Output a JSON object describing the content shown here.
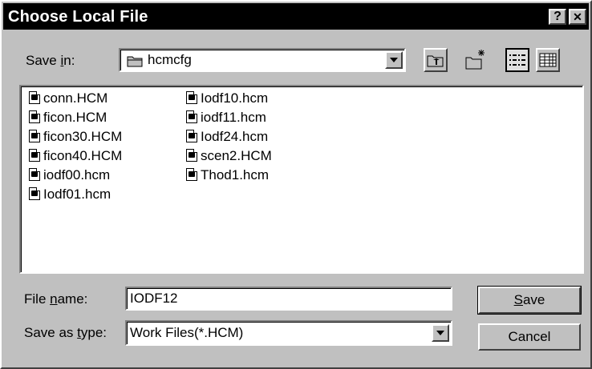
{
  "window": {
    "title": "Choose Local File",
    "help_glyph": "?",
    "close_glyph": "✕"
  },
  "save_in": {
    "label_pre": "Save ",
    "label_key": "i",
    "label_post": "n:",
    "value": "hcmcfg",
    "icon": "folder-icon"
  },
  "toolbar": {
    "up_icon": "up-folder-icon",
    "new_icon": "new-folder-icon",
    "list_icon": "list-view-icon",
    "details_icon": "details-view-icon"
  },
  "files": [
    "conn.HCM",
    "ficon.HCM",
    "ficon30.HCM",
    "ficon40.HCM",
    "iodf00.hcm",
    "Iodf01.hcm",
    "Iodf10.hcm",
    "iodf11.hcm",
    "Iodf24.hcm",
    "scen2.HCM",
    "Thod1.hcm"
  ],
  "file_name": {
    "label_pre": "File ",
    "label_key": "n",
    "label_post": "ame:",
    "value": "IODF12"
  },
  "save_as_type": {
    "label_pre": "Save as ",
    "label_key": "t",
    "label_post": "ype:",
    "value": "Work Files(*.HCM)"
  },
  "buttons": {
    "save_key": "S",
    "save_rest": "ave",
    "cancel": "Cancel"
  },
  "colors": {
    "face": "#c0c0c0",
    "titlebar": "#000000",
    "field": "#ffffff"
  }
}
